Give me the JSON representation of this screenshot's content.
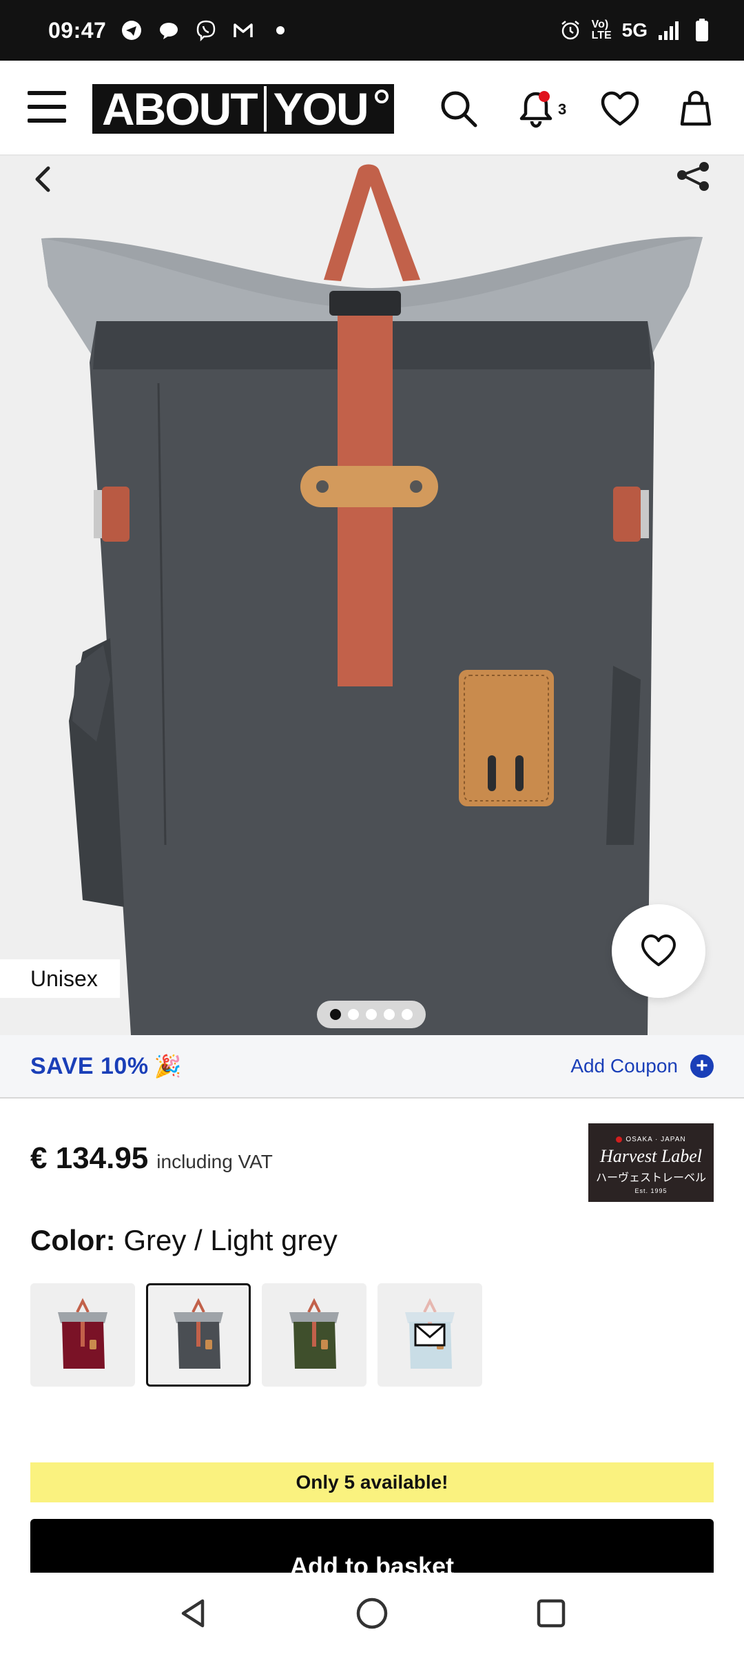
{
  "status_bar": {
    "time": "09:47",
    "network_label": "Vo) LTE",
    "network_type": "5G",
    "icons": [
      "telegram-icon",
      "chat-icon",
      "viber-icon",
      "gmail-icon",
      "dot-icon",
      "alarm-icon",
      "signal-icon",
      "battery-icon"
    ]
  },
  "header": {
    "logo_left": "ABOUT",
    "logo_right": "YOU",
    "notification_count": "3",
    "icons": [
      "menu-icon",
      "search-icon",
      "bell-icon",
      "heart-icon",
      "bag-icon"
    ]
  },
  "gallery": {
    "badge": "Unisex",
    "image_count": 5,
    "active_image": 1,
    "icons": [
      "back-chevron-icon",
      "share-icon",
      "wishlist-heart-icon"
    ]
  },
  "promo": {
    "save_text": "SAVE 10%",
    "save_emoji": "🎉",
    "coupon_label": "Add Coupon"
  },
  "price": {
    "amount": "€ 134.95",
    "vat_label": "including VAT"
  },
  "brand": {
    "top_line": "OSAKA · JAPAN",
    "name": "Harvest Label",
    "japanese": "ハーヴェストレーベル",
    "est": "Est. 1995"
  },
  "color": {
    "label": "Color:",
    "value": "Grey / Light grey",
    "swatches": [
      {
        "name": "swatch-burgundy",
        "body": "#7a1226",
        "top": "#9ea3a8",
        "selected": false
      },
      {
        "name": "swatch-grey",
        "body": "#4a4e53",
        "top": "#9ea3a8",
        "selected": true
      },
      {
        "name": "swatch-green",
        "body": "#3f4f2c",
        "top": "#9ea3a8",
        "selected": false
      },
      {
        "name": "swatch-light-blue",
        "body": "#c9dde6",
        "top": "#d6e3ea",
        "selected": false
      }
    ]
  },
  "availability": {
    "text": "Only 5 available!"
  },
  "cta": {
    "add_to_basket": "Add to basket"
  },
  "colors": {
    "accent_blue": "#1a3fb8",
    "availability_yellow": "#faf27f",
    "strap_orange": "#c2614a"
  }
}
